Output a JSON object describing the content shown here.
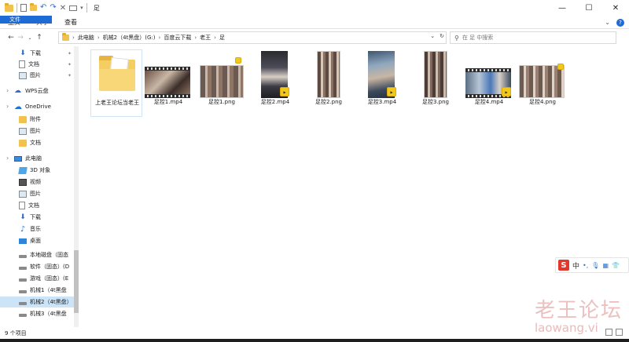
{
  "window": {
    "title": "足"
  },
  "ribbon": {
    "tabs": [
      "文件",
      "主页",
      "共享",
      "查看"
    ]
  },
  "address": {
    "segments": [
      "此电脑",
      "机械2（4t黑盘）(G:)",
      "百度云下载",
      "老王",
      "足"
    ]
  },
  "search": {
    "placeholder": "在 足 中搜索"
  },
  "sidebar": {
    "items": [
      {
        "label": "下载",
        "icon": "download-icon",
        "pinned": true
      },
      {
        "label": "文档",
        "icon": "document-icon",
        "pinned": true
      },
      {
        "label": "图片",
        "icon": "picture-icon",
        "pinned": true
      },
      {
        "label": "WPS云盘",
        "icon": "cloud-icon"
      },
      {
        "label": "OneDrive",
        "icon": "onedrive-icon"
      },
      {
        "label": "附件",
        "icon": "folder-icon"
      },
      {
        "label": "图片",
        "icon": "picture-icon"
      },
      {
        "label": "文档",
        "icon": "folder-icon"
      },
      {
        "label": "此电脑",
        "icon": "computer-icon"
      },
      {
        "label": "3D 对象",
        "icon": "3d-objects-icon"
      },
      {
        "label": "视频",
        "icon": "video-icon"
      },
      {
        "label": "图片",
        "icon": "picture-icon"
      },
      {
        "label": "文档",
        "icon": "document-icon"
      },
      {
        "label": "下载",
        "icon": "download-icon"
      },
      {
        "label": "音乐",
        "icon": "music-icon"
      },
      {
        "label": "桌面",
        "icon": "desktop-icon"
      },
      {
        "label": "本地磁盘（固态",
        "icon": "drive-icon"
      },
      {
        "label": "软件（固态）(D",
        "icon": "drive-icon"
      },
      {
        "label": "游戏（固态）(E",
        "icon": "drive-icon"
      },
      {
        "label": "机械1（4t黑盘",
        "icon": "drive-icon"
      },
      {
        "label": "机械2（4t黑盘）",
        "icon": "drive-icon",
        "selected": true
      },
      {
        "label": "机械3（4t黑盘",
        "icon": "drive-icon"
      }
    ]
  },
  "files": [
    {
      "name": "上老王论坛当老王",
      "type": "folder"
    },
    {
      "name": "足控1.mp4",
      "type": "video"
    },
    {
      "name": "足控1.png",
      "type": "image"
    },
    {
      "name": "足控2.mp4",
      "type": "video"
    },
    {
      "name": "足控2.png",
      "type": "image"
    },
    {
      "name": "足控3.mp4",
      "type": "video"
    },
    {
      "name": "足控3.png",
      "type": "image"
    },
    {
      "name": "足控4.mp4",
      "type": "video"
    },
    {
      "name": "足控4.png",
      "type": "image"
    }
  ],
  "status": {
    "count": "9 个项目"
  },
  "ime": {
    "logo": "S",
    "lang": "中",
    "punct": "•,"
  },
  "watermark": {
    "cn": "老王论坛",
    "en": "laowang.vi"
  },
  "colors": {
    "accent": "#1e6bd6",
    "selection": "#cce4f7",
    "folder": "#f4cd63",
    "badge": "#f3c81c"
  }
}
